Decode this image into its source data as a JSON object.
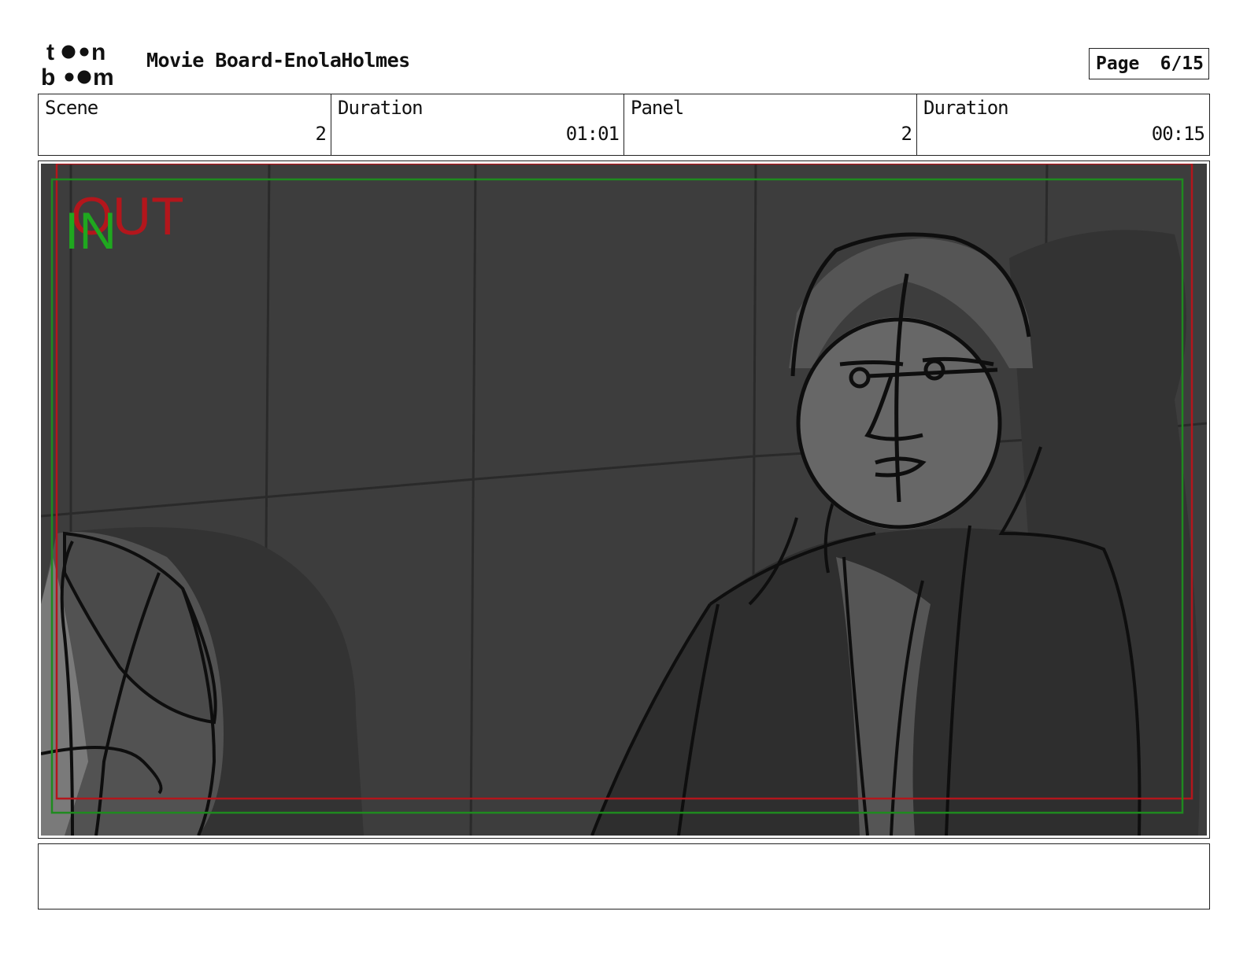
{
  "header": {
    "logo_top": "toon",
    "logo_bottom": "boom",
    "title": "Movie Board-EnolaHolmes",
    "page_label": "Page",
    "page_value": "6/15"
  },
  "info": [
    {
      "label": "Scene",
      "value": "2"
    },
    {
      "label": "Duration",
      "value": "01:01"
    },
    {
      "label": "Panel",
      "value": "2"
    },
    {
      "label": "Duration",
      "value": "00:15"
    }
  ],
  "panel": {
    "overlay_out": "OUT",
    "overlay_in": "IN",
    "colors": {
      "out_frame": "#b3161c",
      "in_frame": "#1f8a1f",
      "background": "#3d3d3d"
    }
  },
  "notes": {
    "text": ""
  }
}
